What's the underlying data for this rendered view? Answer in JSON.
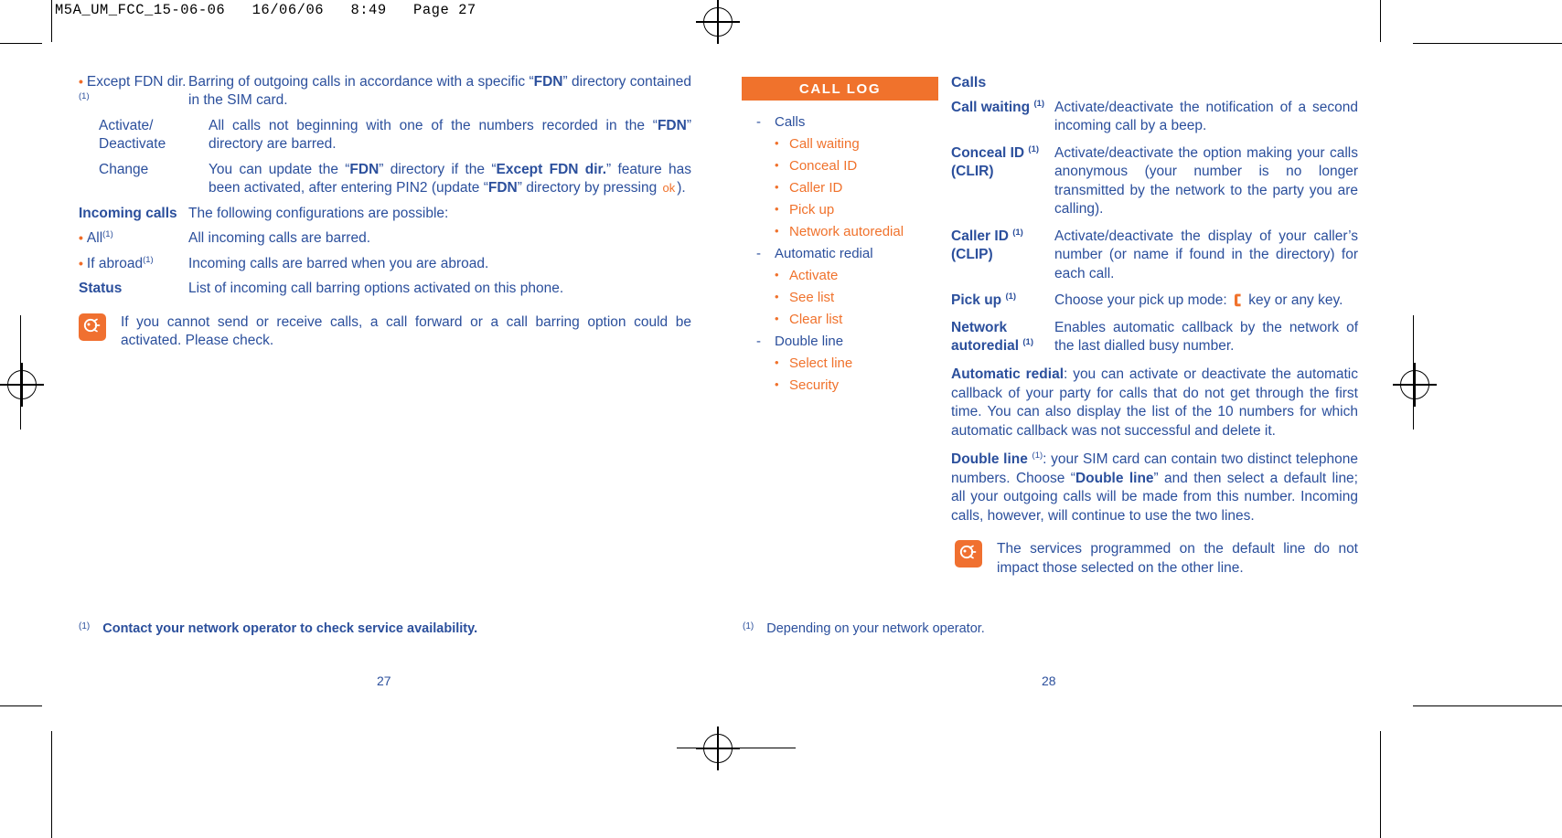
{
  "slug": "M5A_UM_FCC_15-06-06   16/06/06   8:49   Page 27",
  "left_page": {
    "rows": [
      {
        "label": "Except FDN dir.",
        "label_sup": "(1)",
        "bullet": true,
        "text_parts": [
          {
            "t": "Barring of outgoing calls in accordance with a specific “",
            "b": false
          },
          {
            "t": "FDN",
            "b": true
          },
          {
            "t": "” directory contained in the SIM card.",
            "b": false
          }
        ]
      },
      {
        "label": "Activate/ Deactivate",
        "label_sup": "",
        "bullet": false,
        "indent": true,
        "text_parts": [
          {
            "t": "All calls not beginning with one of the numbers recorded in the “",
            "b": false
          },
          {
            "t": "FDN",
            "b": true
          },
          {
            "t": "” directory are barred.",
            "b": false
          }
        ]
      },
      {
        "label": "Change",
        "label_sup": "",
        "bullet": false,
        "indent": true,
        "text_parts": [
          {
            "t": "You can update the “",
            "b": false
          },
          {
            "t": "FDN",
            "b": true
          },
          {
            "t": "” directory if the “",
            "b": false
          },
          {
            "t": "Except FDN dir.",
            "b": true
          },
          {
            "t": "” feature has been activated, after entering PIN2 (update “",
            "b": false
          },
          {
            "t": "FDN",
            "b": true
          },
          {
            "t": "” directory by pressing ",
            "b": false
          },
          {
            "t": "__OK__",
            "b": false
          },
          {
            "t": ").",
            "b": false
          }
        ]
      },
      {
        "label": "Incoming calls",
        "label_sup": "",
        "label_bold": true,
        "bullet": false,
        "text_parts": [
          {
            "t": "The following configurations are possible:",
            "b": false
          }
        ]
      },
      {
        "label": "All",
        "label_sup": "(1)",
        "bullet": true,
        "text_parts": [
          {
            "t": "All incoming calls are barred.",
            "b": false
          }
        ]
      },
      {
        "label": "If abroad",
        "label_sup": "(1)",
        "bullet": true,
        "text_parts": [
          {
            "t": "Incoming calls are barred when you are abroad.",
            "b": false
          }
        ]
      },
      {
        "label": "Status",
        "label_sup": "",
        "label_bold": true,
        "bullet": false,
        "text_parts": [
          {
            "t": "List of incoming call barring options activated on this phone.",
            "b": false
          }
        ]
      }
    ],
    "note": "If you cannot send or receive calls, a call forward or a call barring option could be activated. Please check.",
    "footnote_mark": "(1)",
    "footnote": "Contact your network operator to check service availability.",
    "page_number": "27"
  },
  "call_log": {
    "title": "CALL LOG",
    "tree": [
      {
        "type": "node",
        "label": "Calls"
      },
      {
        "type": "leaf",
        "label": "Call waiting"
      },
      {
        "type": "leaf",
        "label": "Conceal ID"
      },
      {
        "type": "leaf",
        "label": "Caller ID"
      },
      {
        "type": "leaf",
        "label": "Pick up"
      },
      {
        "type": "leaf",
        "label": "Network autoredial"
      },
      {
        "type": "node",
        "label": "Automatic redial"
      },
      {
        "type": "leaf",
        "label": "Activate"
      },
      {
        "type": "leaf",
        "label": "See list"
      },
      {
        "type": "leaf",
        "label": "Clear list"
      },
      {
        "type": "node",
        "label": "Double line"
      },
      {
        "type": "leaf",
        "label": "Select line"
      },
      {
        "type": "leaf",
        "label": "Security"
      }
    ],
    "dash": "-",
    "dot": "•"
  },
  "right_page": {
    "heading": "Calls",
    "rows": [
      {
        "label": "Call waiting",
        "label_sup": "(1)",
        "label_line2": "",
        "text": "Activate/deactivate the notification of a second incoming call by a beep."
      },
      {
        "label": "Conceal ID",
        "label_sup": "(1)",
        "label_line2": "(CLIR)",
        "text": "Activate/deactivate the option making your calls anonymous (your number is no longer transmitted by the network to the party you are calling)."
      },
      {
        "label": "Caller ID",
        "label_sup": "(1)",
        "label_line2": "(CLIP)",
        "text": "Activate/deactivate the display of your caller’s number (or name if found in the directory) for each call."
      },
      {
        "label": "Pick up",
        "label_sup": "(1)",
        "label_line2": "",
        "text_pre": "Choose your pick up mode:",
        "has_handset_icon": true,
        "text_post": "key or any key."
      },
      {
        "label": "Network autoredial",
        "label_sup": "(1)",
        "label_line2": "",
        "text": "Enables automatic callback by the network of the last dialled busy number."
      }
    ],
    "paragraphs": [
      {
        "parts": [
          {
            "t": "Automatic redial",
            "b": true
          },
          {
            "t": ": you can activate or deactivate the automatic callback of your party for calls that do not get through the first time. You can also display the list of the 10 numbers for which automatic callback was not successful and delete it.",
            "b": false
          }
        ]
      },
      {
        "parts": [
          {
            "t": "Double line ",
            "b": true
          },
          {
            "t": "__SUP1__",
            "b": false
          },
          {
            "t": ": your SIM card can contain two distinct telephone numbers. Choose “",
            "b": false
          },
          {
            "t": "Double line",
            "b": true
          },
          {
            "t": "” and then select a default line; all your outgoing calls will be made from this number. Incoming calls, however, will continue to use the two lines.",
            "b": false
          }
        ]
      }
    ],
    "note": "The services programmed on the default line do not impact those selected on the other line.",
    "footnote_mark": "(1)",
    "footnote": "Depending on your network operator.",
    "page_number": "28"
  },
  "colors": {
    "text_blue": "#2b4f9c",
    "accent_orange": "#f0722c",
    "header_bar": "#f0722c"
  }
}
